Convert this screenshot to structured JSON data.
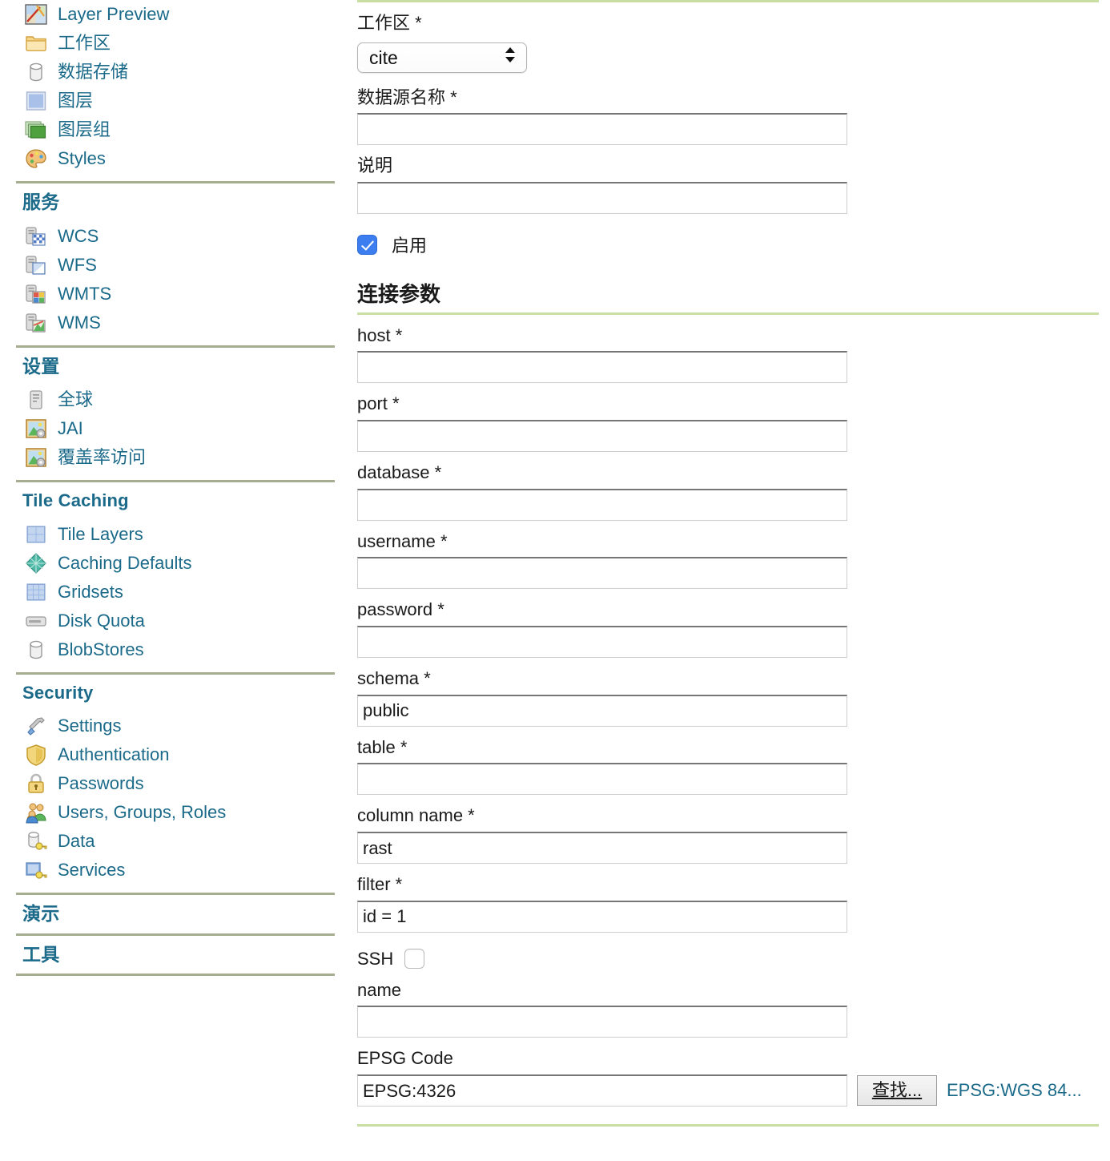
{
  "sidebar": {
    "groups": [
      {
        "id": "data",
        "heading": null,
        "items": [
          {
            "label": "Layer Preview",
            "icon": "layer-preview-icon"
          },
          {
            "label": "工作区",
            "icon": "workspace-folder-icon"
          },
          {
            "label": "数据存储",
            "icon": "datastore-cylinder-icon"
          },
          {
            "label": "图层",
            "icon": "layer-square-icon"
          },
          {
            "label": "图层组",
            "icon": "layer-group-icon"
          },
          {
            "label": "Styles",
            "icon": "styles-palette-icon"
          }
        ]
      },
      {
        "id": "services",
        "heading": "服务",
        "items": [
          {
            "label": "WCS",
            "icon": "wcs-server-icon"
          },
          {
            "label": "WFS",
            "icon": "wfs-server-icon"
          },
          {
            "label": "WMTS",
            "icon": "wmts-server-icon"
          },
          {
            "label": "WMS",
            "icon": "wms-server-icon"
          }
        ]
      },
      {
        "id": "settings",
        "heading": "设置",
        "items": [
          {
            "label": "全球",
            "icon": "global-server-icon"
          },
          {
            "label": "JAI",
            "icon": "jai-image-icon"
          },
          {
            "label": "覆盖率访问",
            "icon": "coverage-access-icon"
          }
        ]
      },
      {
        "id": "tile-caching",
        "heading": "Tile Caching",
        "items": [
          {
            "label": "Tile Layers",
            "icon": "tile-layers-icon"
          },
          {
            "label": "Caching Defaults",
            "icon": "caching-defaults-globe-icon"
          },
          {
            "label": "Gridsets",
            "icon": "gridsets-icon"
          },
          {
            "label": "Disk Quota",
            "icon": "disk-quota-icon"
          },
          {
            "label": "BlobStores",
            "icon": "blobstores-cylinder-icon"
          }
        ]
      },
      {
        "id": "security",
        "heading": "Security",
        "items": [
          {
            "label": "Settings",
            "icon": "settings-screwdriver-icon"
          },
          {
            "label": "Authentication",
            "icon": "authentication-shield-icon"
          },
          {
            "label": "Passwords",
            "icon": "passwords-lock-icon"
          },
          {
            "label": "Users, Groups, Roles",
            "icon": "users-groups-roles-icon"
          },
          {
            "label": "Data",
            "icon": "data-key-icon"
          },
          {
            "label": "Services",
            "icon": "services-key-icon"
          }
        ]
      },
      {
        "id": "demos",
        "heading": "演示",
        "items": []
      },
      {
        "id": "tools",
        "heading": "工具",
        "items": []
      }
    ]
  },
  "main": {
    "workspace": {
      "label": "工作区 *",
      "selected": "cite",
      "options": [
        "cite"
      ]
    },
    "datasource_name": {
      "label": "数据源名称 *",
      "value": "",
      "placeholder": ""
    },
    "description": {
      "label": "说明",
      "value": "",
      "placeholder": ""
    },
    "enabled": {
      "label": "启用",
      "checked": true
    },
    "connection_section_title": "连接参数",
    "connection_params": [
      {
        "name": "host",
        "label": "host *",
        "value": "",
        "placeholder": ""
      },
      {
        "name": "port",
        "label": "port *",
        "value": "",
        "placeholder": ""
      },
      {
        "name": "database",
        "label": "database *",
        "value": "",
        "placeholder": ""
      },
      {
        "name": "username",
        "label": "username *",
        "value": "",
        "placeholder": ""
      },
      {
        "name": "password",
        "label": "password *",
        "value": "",
        "placeholder": ""
      },
      {
        "name": "schema",
        "label": "schema *",
        "value": "public",
        "placeholder": ""
      },
      {
        "name": "table",
        "label": "table *",
        "value": "",
        "placeholder": ""
      },
      {
        "name": "column_name",
        "label": "column name *",
        "value": "rast",
        "placeholder": ""
      },
      {
        "name": "filter",
        "label": "filter *",
        "value": "id = 1",
        "placeholder": ""
      }
    ],
    "ssh": {
      "label": "SSH",
      "checked": false
    },
    "name_field": {
      "label": "name",
      "value": "",
      "placeholder": ""
    },
    "epsg": {
      "label": "EPSG Code",
      "value": "EPSG:4326",
      "placeholder": "",
      "find_button": "查找...",
      "link_text": "EPSG:WGS 84..."
    }
  },
  "colors": {
    "link": "#1b6a8a",
    "divider_green": "#c9dea2",
    "divider_sidebar": "#a6ae92",
    "checkbox_on": "#3c7df0"
  }
}
